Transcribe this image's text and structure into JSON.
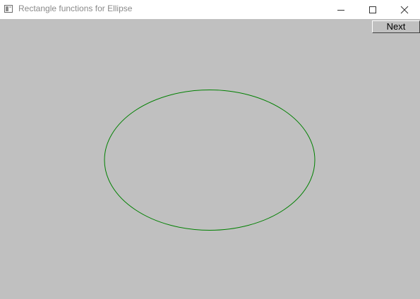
{
  "window": {
    "title": "Rectangle functions for Ellipse",
    "controls": {
      "minimize_icon": "minimize-icon",
      "maximize_icon": "maximize-icon",
      "close_icon": "close-icon"
    }
  },
  "client": {
    "background_color": "#c0c0c0",
    "next_button_label": "Next",
    "ellipse": {
      "stroke_color": "#008000"
    }
  }
}
